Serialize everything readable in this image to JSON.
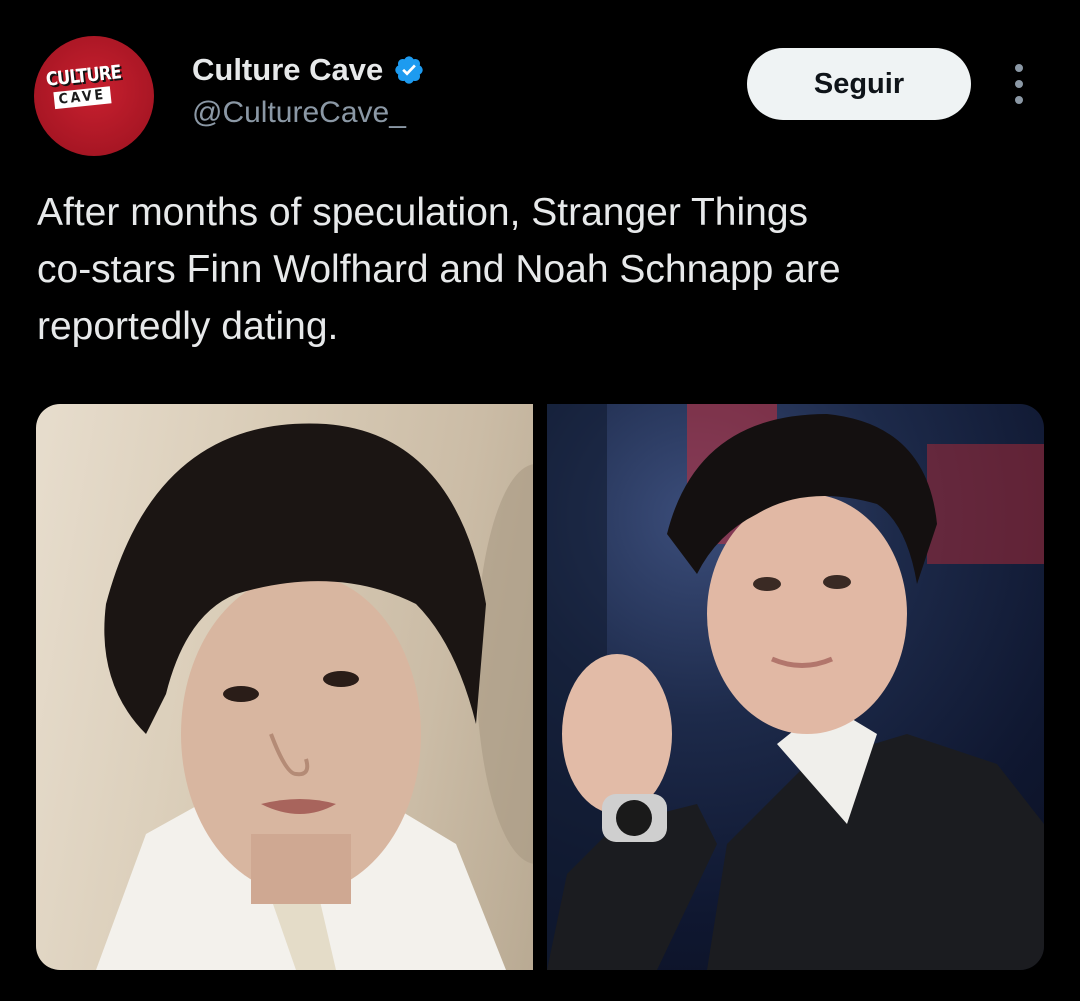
{
  "author": {
    "avatar_line1": "CULTURE",
    "avatar_line2": "CAVE",
    "display_name": "Culture Cave",
    "handle": "@CultureCave_",
    "verified_icon": "verified-badge-icon"
  },
  "actions": {
    "follow_label": "Seguir",
    "more_icon": "more-vertical-icon"
  },
  "tweet": {
    "text": "After months of speculation, Stranger Things\nco-stars Finn Wolfhard and Noah Schnapp are\nreportedly dating."
  },
  "media": {
    "photos": [
      {
        "name": "photo-portrait-left"
      },
      {
        "name": "photo-portrait-right"
      }
    ]
  },
  "colors": {
    "background": "#000000",
    "text_primary": "#e7e9ea",
    "text_secondary": "#8b98a5",
    "verified_blue": "#1d9bf0",
    "avatar_red": "#c8202f",
    "follow_button_bg": "#eff3f4"
  }
}
